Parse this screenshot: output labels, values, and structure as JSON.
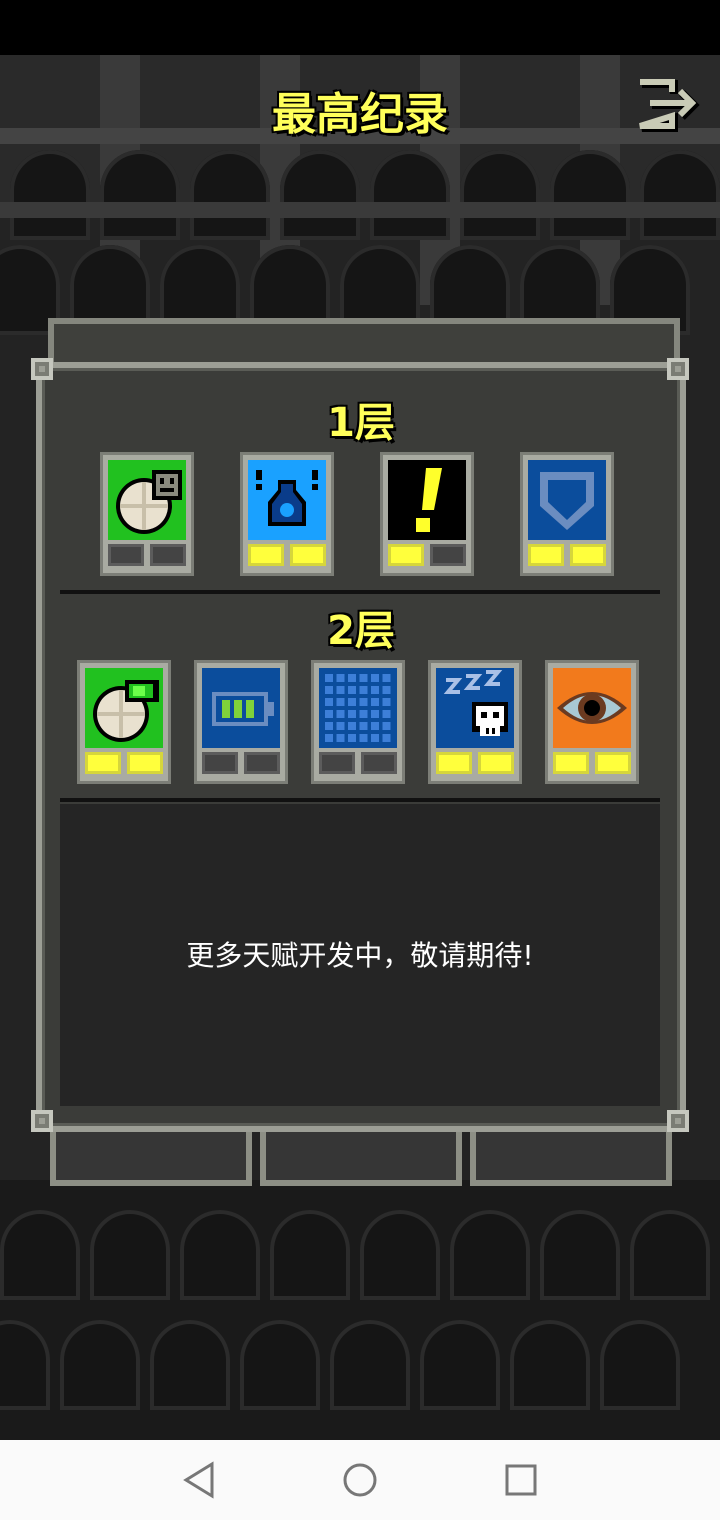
{
  "header": {
    "title": "最高纪录",
    "exit_icon": "exit-icon"
  },
  "talents_panel": {
    "tiers": [
      {
        "label": "1层",
        "talents": [
          {
            "icon": "food-ration-icon",
            "colors": [
              "#21c11f",
              "#e9e1cf"
            ],
            "points": 0,
            "max_points": 2
          },
          {
            "icon": "potion-identify-icon",
            "colors": [
              "#1aa1ff",
              "#0a3c8a"
            ],
            "points": 2,
            "max_points": 2
          },
          {
            "icon": "alert-exclamation-icon",
            "colors": [
              "#000000",
              "#ffff2b"
            ],
            "points": 1,
            "max_points": 2
          },
          {
            "icon": "shield-icon",
            "colors": [
              "#0b4d9c",
              "#6b8dc0"
            ],
            "points": 2,
            "max_points": 2
          }
        ]
      },
      {
        "label": "2层",
        "talents": [
          {
            "icon": "food-recharge-icon",
            "colors": [
              "#21c11f",
              "#e9e1cf"
            ],
            "points": 2,
            "max_points": 2
          },
          {
            "icon": "battery-icon",
            "colors": [
              "#0b4d9c",
              "#7fd23a"
            ],
            "points": 0,
            "max_points": 2
          },
          {
            "icon": "grid-icon",
            "colors": [
              "#0b4d9c",
              "#3d7fd8"
            ],
            "points": 0,
            "max_points": 2
          },
          {
            "icon": "sleep-skull-icon",
            "colors": [
              "#0b4d9c",
              "#ffffff"
            ],
            "points": 2,
            "max_points": 2
          },
          {
            "icon": "eye-icon",
            "colors": [
              "#f27a1c",
              "#a9c9d4"
            ],
            "points": 2,
            "max_points": 2
          }
        ]
      }
    ],
    "more_text": "更多天赋开发中，敬请期待!"
  },
  "navbar": {
    "back_icon": "back-triangle-icon",
    "home_icon": "home-circle-icon",
    "recents_icon": "recents-square-icon"
  }
}
